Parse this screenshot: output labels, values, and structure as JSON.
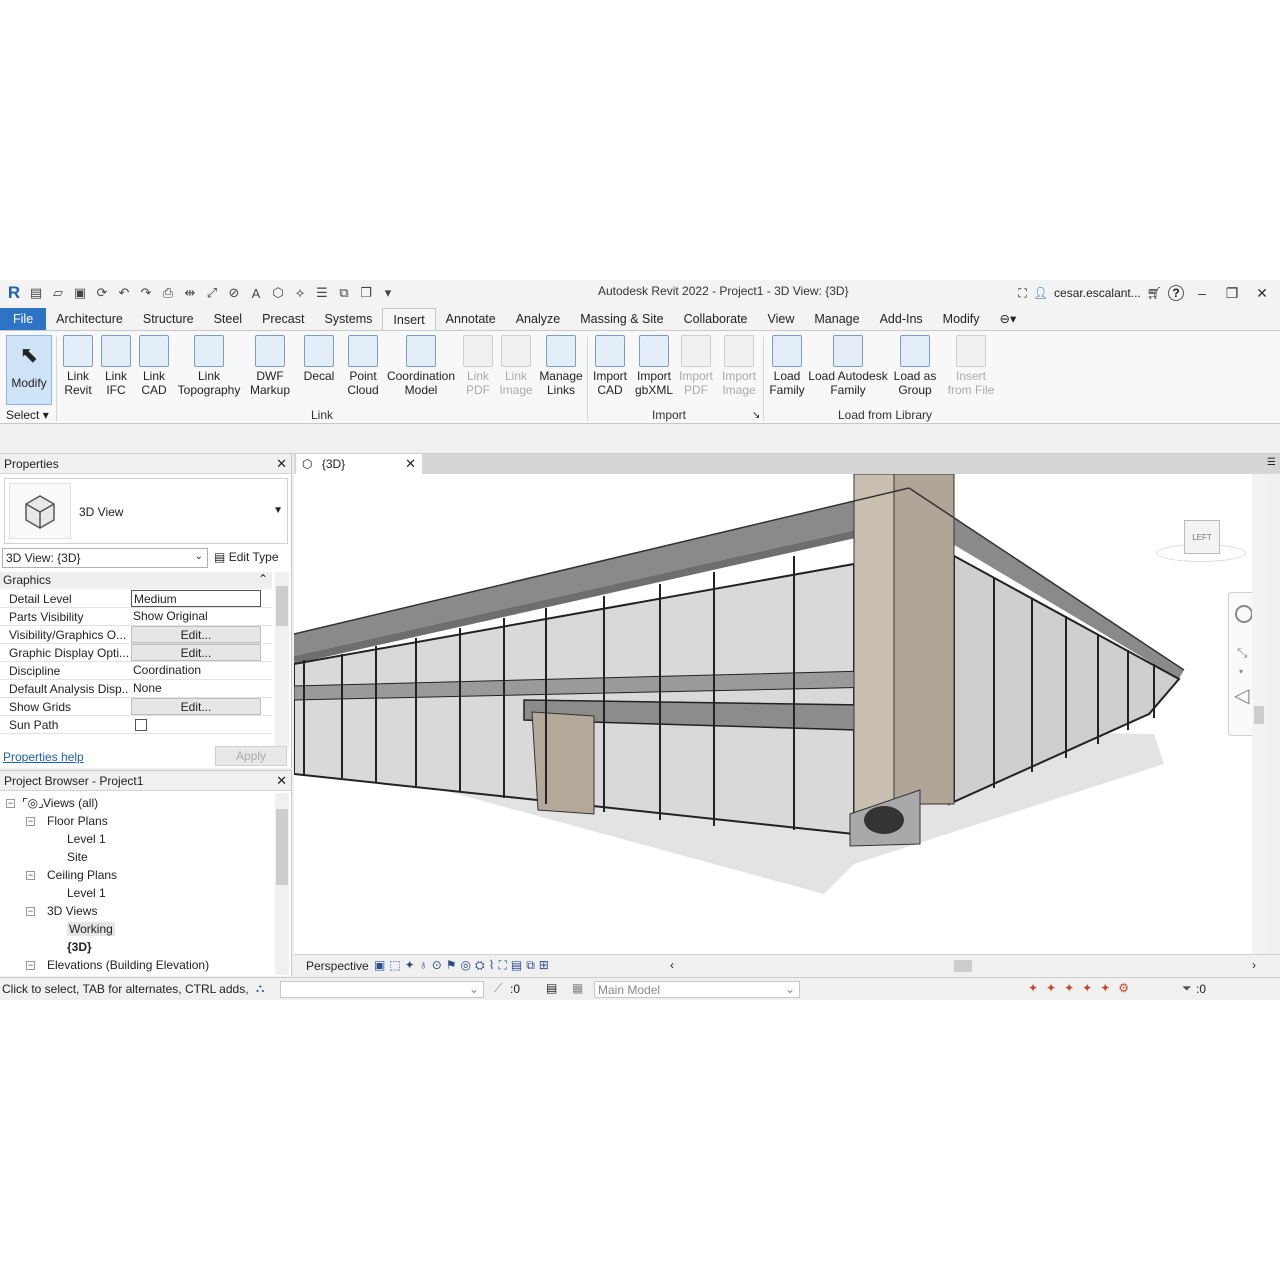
{
  "title_bar": {
    "app_title": "Autodesk Revit 2022 - Project1 - 3D View: {3D}",
    "user": "cesar.escalant...",
    "help": "?"
  },
  "ribbon_tabs": [
    "File",
    "Architecture",
    "Structure",
    "Steel",
    "Precast",
    "Systems",
    "Insert",
    "Annotate",
    "Analyze",
    "Massing & Site",
    "Collaborate",
    "View",
    "Manage",
    "Add-Ins",
    "Modify"
  ],
  "active_tab": "Insert",
  "ribbon": {
    "modify": "Modify",
    "select": "Select",
    "buttons": [
      {
        "l1": "Link",
        "l2": "Revit",
        "icon": "link-revit-icon",
        "dim": false
      },
      {
        "l1": "Link",
        "l2": "IFC",
        "icon": "link-ifc-icon",
        "dim": false
      },
      {
        "l1": "Link",
        "l2": "CAD",
        "icon": "link-cad-icon",
        "dim": false
      },
      {
        "l1": "Link",
        "l2": "Topography",
        "icon": "link-topography-icon",
        "dim": false
      },
      {
        "l1": "DWF",
        "l2": "Markup",
        "icon": "dwf-markup-icon",
        "dim": false
      },
      {
        "l1": "Decal",
        "l2": "",
        "icon": "decal-icon",
        "dim": false
      },
      {
        "l1": "Point",
        "l2": "Cloud",
        "icon": "point-cloud-icon",
        "dim": false
      },
      {
        "l1": "Coordination",
        "l2": "Model",
        "icon": "coordination-model-icon",
        "dim": false
      },
      {
        "l1": "Link",
        "l2": "PDF",
        "icon": "link-pdf-icon",
        "dim": true
      },
      {
        "l1": "Link",
        "l2": "Image",
        "icon": "link-image-icon",
        "dim": true
      },
      {
        "l1": "Manage",
        "l2": "Links",
        "icon": "manage-links-icon",
        "dim": false
      },
      {
        "l1": "Import",
        "l2": "CAD",
        "icon": "import-cad-icon",
        "dim": false
      },
      {
        "l1": "Import",
        "l2": "gbXML",
        "icon": "import-gbxml-icon",
        "dim": false
      },
      {
        "l1": "Import",
        "l2": "PDF",
        "icon": "import-pdf-icon",
        "dim": true
      },
      {
        "l1": "Import",
        "l2": "Image",
        "icon": "import-image-icon",
        "dim": true
      },
      {
        "l1": "Load",
        "l2": "Family",
        "icon": "load-family-icon",
        "dim": false
      },
      {
        "l1": "Load Autodesk",
        "l2": "Family",
        "icon": "load-autodesk-family-icon",
        "dim": false
      },
      {
        "l1": "Load as",
        "l2": "Group",
        "icon": "load-as-group-icon",
        "dim": false
      },
      {
        "l1": "Insert",
        "l2": "from File",
        "icon": "insert-from-file-icon",
        "dim": true
      }
    ],
    "panels": {
      "link": "Link",
      "import": "Import",
      "load_from_library": "Load from Library"
    }
  },
  "properties": {
    "title": "Properties",
    "type_name": "3D View",
    "view_selector": "3D View: {3D}",
    "edit_type": "Edit Type",
    "group": "Graphics",
    "rows": [
      {
        "key": "Detail Level",
        "value": "Medium",
        "style": "box"
      },
      {
        "key": "Parts Visibility",
        "value": "Show Original",
        "style": "plain"
      },
      {
        "key": "Visibility/Graphics O...",
        "value": "Edit...",
        "style": "btn"
      },
      {
        "key": "Graphic Display Opti...",
        "value": "Edit...",
        "style": "btn"
      },
      {
        "key": "Discipline",
        "value": "Coordination",
        "style": "plain"
      },
      {
        "key": "Default Analysis Disp...",
        "value": "None",
        "style": "plain"
      },
      {
        "key": "Show Grids",
        "value": "Edit...",
        "style": "btn"
      },
      {
        "key": "Sun Path",
        "value": "",
        "style": "check"
      }
    ],
    "help_link": "Properties help",
    "apply": "Apply"
  },
  "project_browser": {
    "title": "Project Browser - Project1",
    "nodes": [
      {
        "label": "Views (all)",
        "depth": 0,
        "toggle": "−",
        "selected": false,
        "bold": false
      },
      {
        "label": "Floor Plans",
        "depth": 1,
        "toggle": "−",
        "selected": false,
        "bold": false
      },
      {
        "label": "Level 1",
        "depth": 2,
        "toggle": "",
        "selected": false,
        "bold": false
      },
      {
        "label": "Site",
        "depth": 2,
        "toggle": "",
        "selected": false,
        "bold": false
      },
      {
        "label": "Ceiling Plans",
        "depth": 1,
        "toggle": "−",
        "selected": false,
        "bold": false
      },
      {
        "label": "Level 1",
        "depth": 2,
        "toggle": "",
        "selected": false,
        "bold": false
      },
      {
        "label": "3D Views",
        "depth": 1,
        "toggle": "−",
        "selected": false,
        "bold": false
      },
      {
        "label": "Working",
        "depth": 2,
        "toggle": "",
        "selected": true,
        "bold": false
      },
      {
        "label": "{3D}",
        "depth": 2,
        "toggle": "",
        "selected": false,
        "bold": true
      },
      {
        "label": "Elevations (Building Elevation)",
        "depth": 1,
        "toggle": "−",
        "selected": false,
        "bold": false
      }
    ]
  },
  "view": {
    "tab_label": "{3D}",
    "viewcube_face": "LEFT",
    "perspective": "Perspective"
  },
  "status_bar": {
    "message": "Click to select, TAB for alternates, CTRL adds, SH",
    "worksets_count": ":0",
    "model": "Main Model",
    "filter_count": ":0"
  },
  "colors": {
    "accent": "#2e74c6",
    "selected_btn": "#cfe3f7",
    "link": "#1a5fb4"
  }
}
